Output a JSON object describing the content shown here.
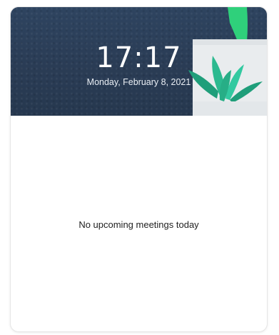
{
  "clock": {
    "time": "17:17",
    "date": "Monday, February 8, 2021"
  },
  "meetings": {
    "empty_message": "No upcoming meetings today"
  },
  "colors": {
    "header_bg": "#2a3d55",
    "plant_dark": "#1f9e7a",
    "plant_light": "#32c9a0",
    "plant_bright": "#2fd07b",
    "pot": "#e9ecee"
  },
  "icons": {
    "decoration": "plant-illustration"
  }
}
